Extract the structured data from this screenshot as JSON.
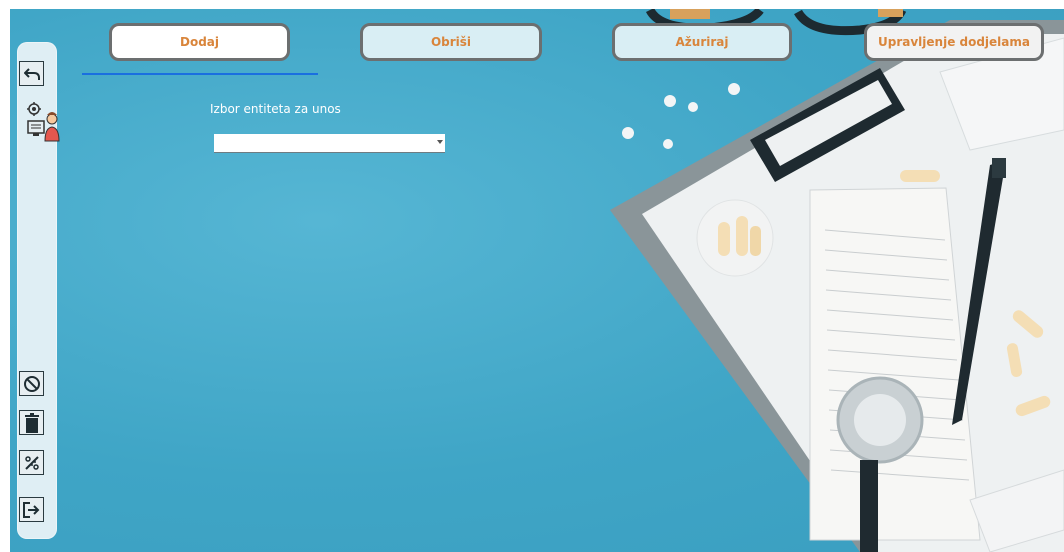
{
  "tabs": {
    "add": "Dodaj",
    "delete": "Obriši",
    "update": "Ažuriraj",
    "manage": "Upravljenje dodjelama"
  },
  "form": {
    "entity_label": "Izbor entiteta za unos",
    "entity_value": ""
  },
  "sidebar": {
    "tools": [
      "undo-icon",
      "admin-icon",
      "cancel-icon",
      "trash-icon",
      "clear-filter-icon",
      "logout-icon"
    ]
  },
  "colors": {
    "background": "#3fa5c6",
    "tab_text": "#d9853b",
    "underline": "#1a6fe0",
    "sidebar": "#dfeef4"
  }
}
